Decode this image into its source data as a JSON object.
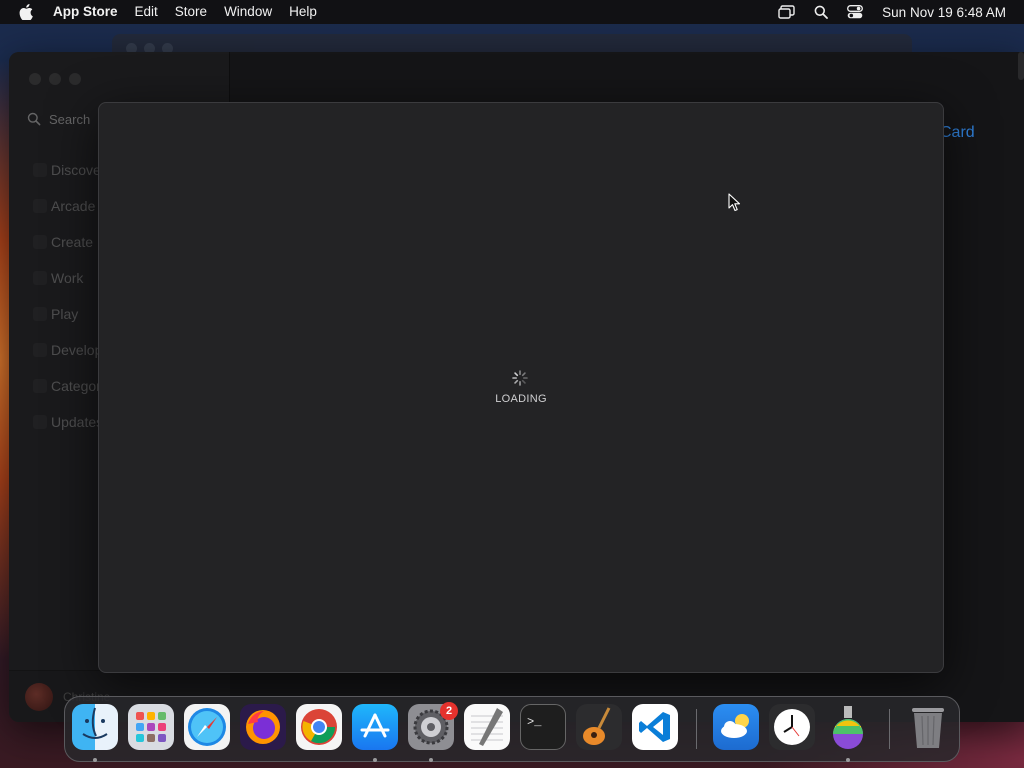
{
  "menubar": {
    "app_name": "App Store",
    "menus": [
      "Edit",
      "Store",
      "Window",
      "Help"
    ],
    "clock": "Sun Nov 19  6:48 AM"
  },
  "sidebar": {
    "search_placeholder": "Search",
    "items": [
      {
        "label": "Discover"
      },
      {
        "label": "Arcade"
      },
      {
        "label": "Create"
      },
      {
        "label": "Work"
      },
      {
        "label": "Play"
      },
      {
        "label": "Develop"
      },
      {
        "label": "Categories"
      },
      {
        "label": "Updates"
      }
    ],
    "account_name": "Christine"
  },
  "main": {
    "link_text": "Card"
  },
  "sheet": {
    "status_text": "LOADING"
  },
  "dock": {
    "apps": [
      {
        "name": "Finder",
        "icon": "finder-icon",
        "running": true
      },
      {
        "name": "Launchpad",
        "icon": "launchpad-icon",
        "running": false
      },
      {
        "name": "Safari",
        "icon": "safari-icon",
        "running": false
      },
      {
        "name": "Firefox",
        "icon": "firefox-icon",
        "running": false
      },
      {
        "name": "Chrome",
        "icon": "chrome-icon",
        "running": false
      },
      {
        "name": "App Store",
        "icon": "app-store-icon",
        "running": true
      },
      {
        "name": "System Settings",
        "icon": "system-settings-icon",
        "running": true,
        "badge": "2"
      },
      {
        "name": "TextEdit",
        "icon": "textedit-icon",
        "running": false
      },
      {
        "name": "Terminal",
        "icon": "terminal-icon",
        "running": false
      },
      {
        "name": "GarageBand",
        "icon": "garageband-icon",
        "running": false
      },
      {
        "name": "VS Code",
        "icon": "vscode-icon",
        "running": false
      },
      {
        "name": "Weather",
        "icon": "weather-icon",
        "running": false
      },
      {
        "name": "Clock",
        "icon": "clock-icon",
        "running": false
      },
      {
        "name": "Automator",
        "icon": "automator-icon",
        "running": true
      },
      {
        "name": "Trash",
        "icon": "trash-icon",
        "running": false
      }
    ]
  },
  "colors": {
    "accent_link": "#2f7fd8",
    "badge": "#e5322d"
  }
}
